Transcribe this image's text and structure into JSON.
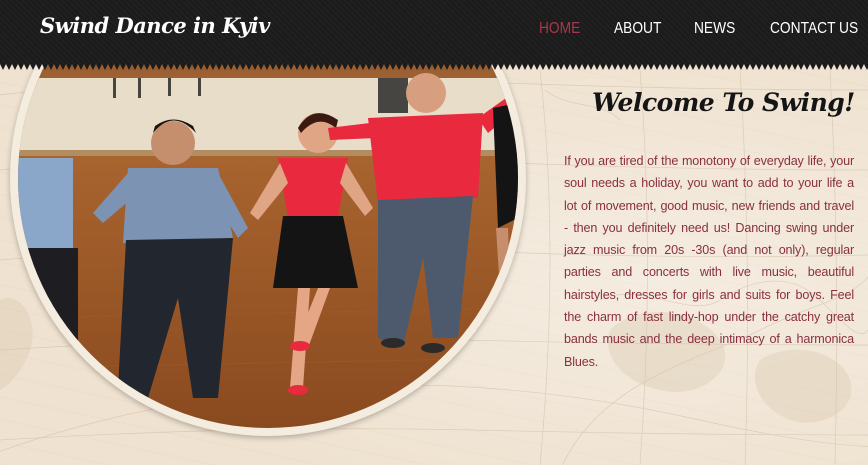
{
  "header": {
    "logo": "Swind Dance in Kyiv"
  },
  "nav": {
    "items": [
      {
        "label": "HOME",
        "active": true
      },
      {
        "label": "ABOUT",
        "active": false
      },
      {
        "label": "NEWS",
        "active": false
      },
      {
        "label": "CONTACT US",
        "active": false
      }
    ]
  },
  "content": {
    "title": "Welcome To Swing!",
    "paragraph": "If you are tired of the monotony of everyday life, your soul needs a holiday, you want to add to your life a lot of movement, good music, new friends and travel - then you definitely need us! Dancing swing under jazz music from 20s -30s (and not only), regular parties and concerts with live music, beautiful hairstyles, dresses for girls and suits for boys. Feel the charm of fast lindy-hop under the catchy great bands music and the deep intimacy of a harmonica Blues."
  },
  "colors": {
    "header_bg": "#1b1b1b",
    "active_nav": "#a8374a",
    "body_text": "#8b2f40",
    "page_bg": "#efe2d0"
  }
}
